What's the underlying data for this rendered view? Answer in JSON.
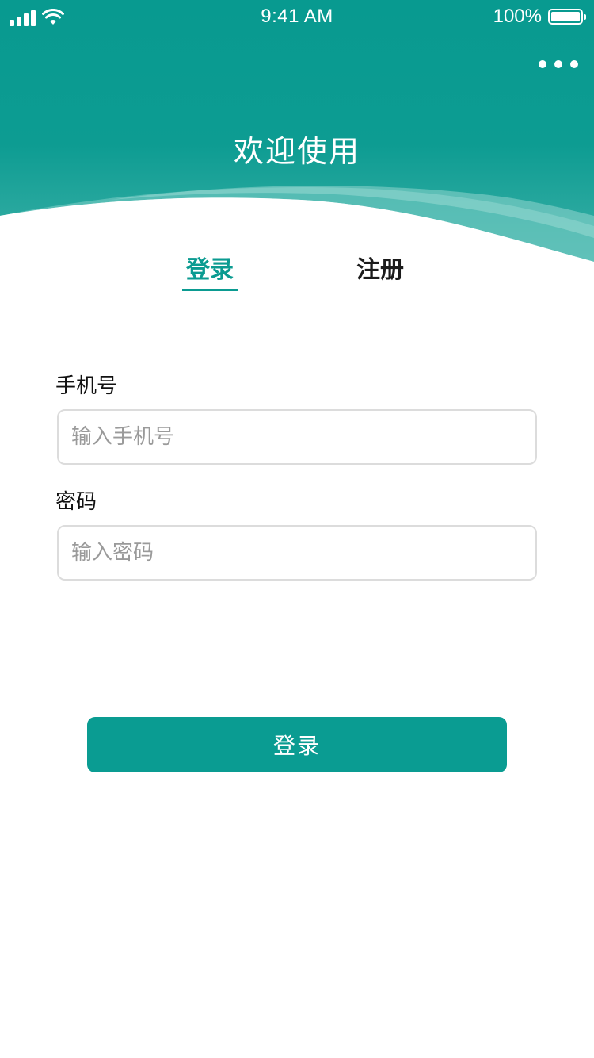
{
  "status_bar": {
    "time": "9:41 AM",
    "battery_percent": "100%",
    "battery_level": 1.0,
    "signal_icon": "cellular-signal-icon",
    "wifi_icon": "wifi-icon",
    "battery_icon": "battery-icon"
  },
  "header": {
    "title": "欢迎使用",
    "menu_icon": "more-horizontal-icon"
  },
  "tabs": [
    {
      "label": "登录",
      "active": true
    },
    {
      "label": "注册",
      "active": false
    }
  ],
  "form": {
    "phone": {
      "label": "手机号",
      "placeholder": "输入手机号",
      "value": ""
    },
    "password": {
      "label": "密码",
      "placeholder": "输入密码",
      "value": ""
    },
    "submit_label": "登录"
  },
  "colors": {
    "primary": "#0b9b91",
    "header_dark": "#089a90",
    "header_light": "#3fb3aa",
    "input_border": "#dcdcdc",
    "placeholder": "#9a9a9a",
    "text": "#111111"
  }
}
